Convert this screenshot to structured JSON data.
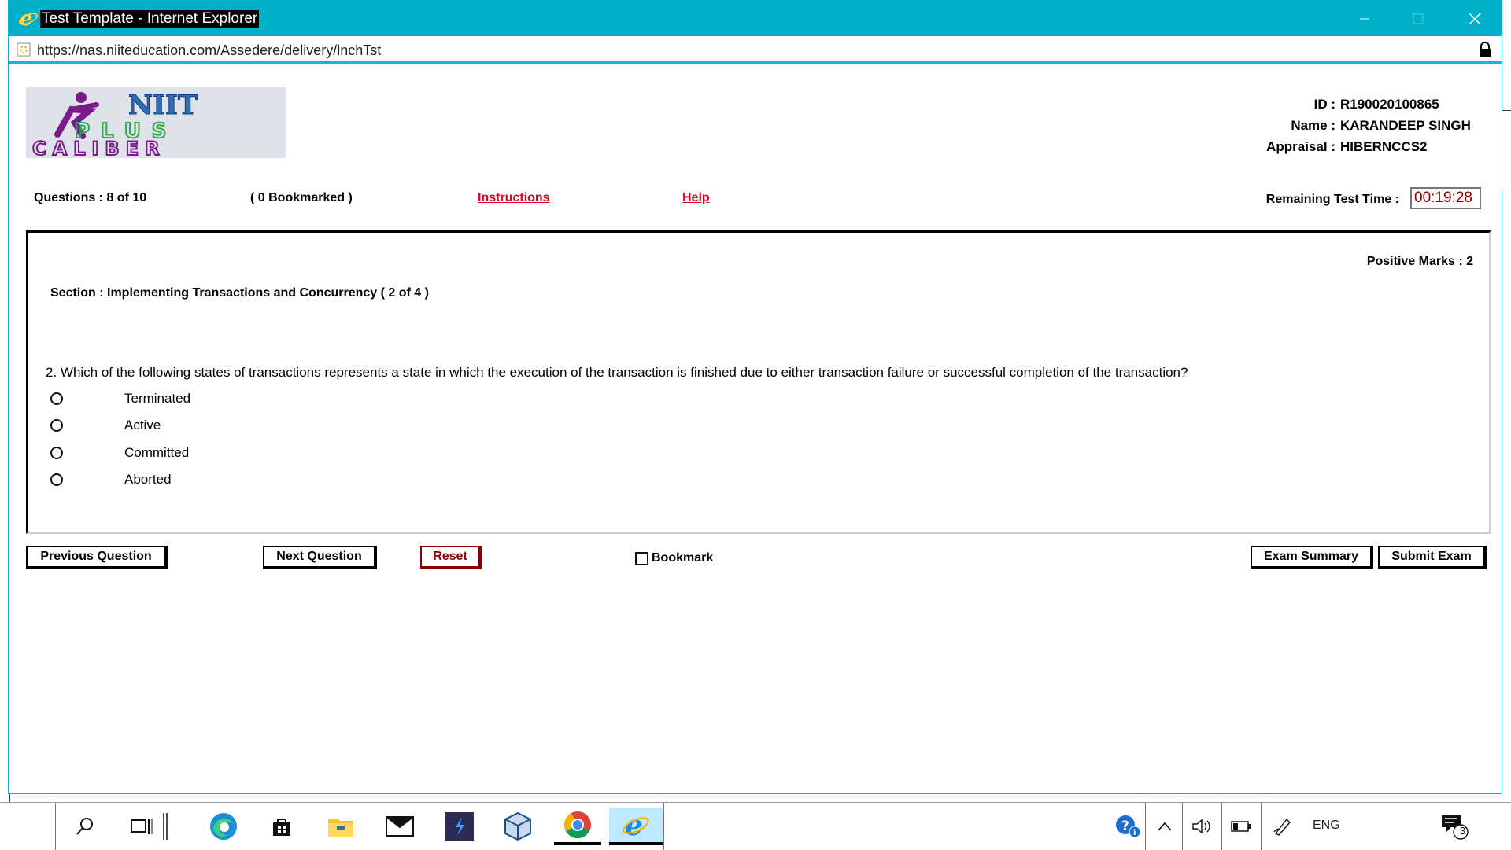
{
  "window": {
    "title": "Test Template - Internet Explorer",
    "url": "https://nas.niiteducation.com/Assedere/delivery/lnchTst"
  },
  "logo": {
    "line1": "NIIT",
    "line2": "PLUS",
    "line3": "CALIBER"
  },
  "user": {
    "id_label": "ID :",
    "id_value": "R190020100865",
    "name_label": "Name :",
    "name_value": "KARANDEEP SINGH",
    "appraisal_label": "Appraisal :",
    "appraisal_value": "HIBERNCCS2"
  },
  "status": {
    "questions": "Questions : 8 of 10",
    "bookmarked": "( 0 Bookmarked )",
    "instructions": "Instructions",
    "help": "Help",
    "timer_label": "Remaining Test Time :",
    "timer_value": "00:19:28"
  },
  "question": {
    "positive_marks": "Positive Marks : 2",
    "section": "Section : Implementing Transactions and Concurrency ( 2 of 4 )",
    "text": "2. Which of the following states of transactions represents a state in which the execution of the transaction is finished due to either transaction failure or successful completion of the transaction?",
    "options": [
      "Terminated",
      "Active",
      "Committed",
      "Aborted"
    ]
  },
  "actions": {
    "previous": "Previous Question",
    "next": "Next Question",
    "reset": "Reset",
    "bookmark": "Bookmark",
    "summary": "Exam Summary",
    "submit": "Submit Exam"
  },
  "taskbar": {
    "language": "ENG",
    "notification_count": "3"
  },
  "colors": {
    "titlebar": "#00b0c8",
    "link": "#e3001b",
    "timer_text": "#8b0000"
  }
}
